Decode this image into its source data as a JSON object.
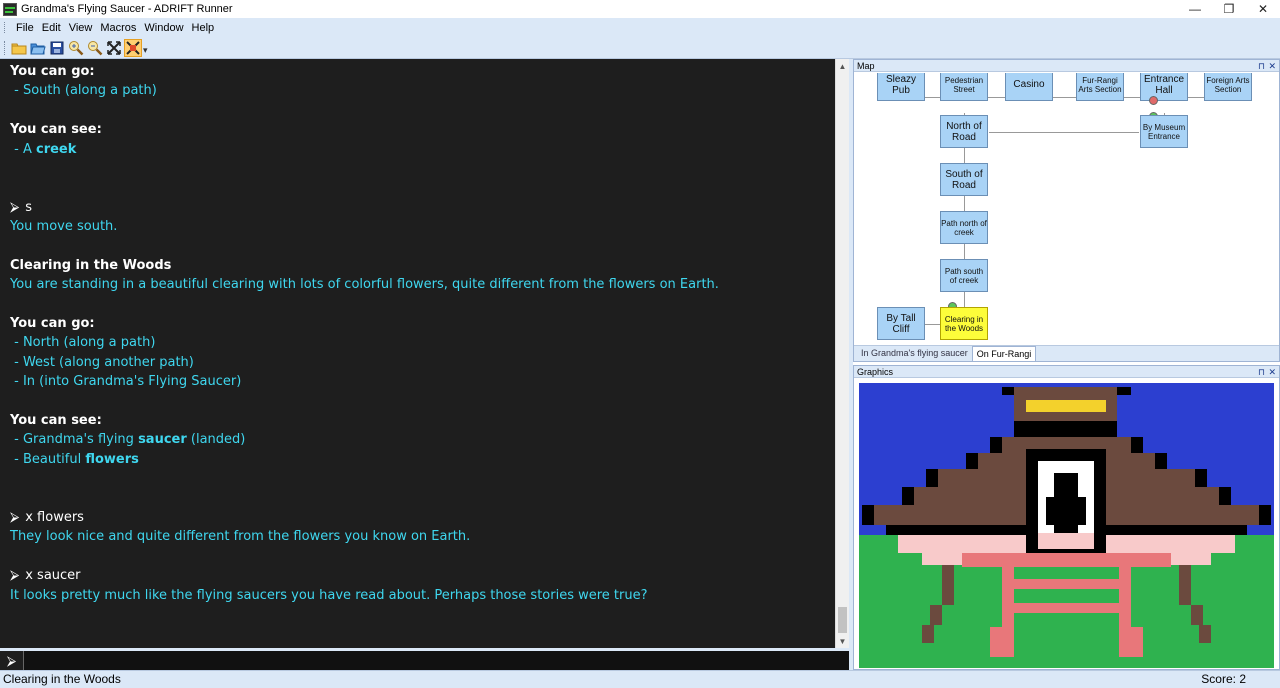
{
  "window": {
    "title": "Grandma's Flying Saucer - ADRIFT Runner",
    "minimize": "—",
    "restore": "❐",
    "close": "✕"
  },
  "menu": [
    "File",
    "Edit",
    "View",
    "Macros",
    "Window",
    "Help"
  ],
  "toolbar": {
    "buttons": [
      "open-folder-icon",
      "open-file-icon",
      "save-icon",
      "zoom-in-icon",
      "zoom-out-icon",
      "fullscreen-icon",
      "map-toggle-icon"
    ],
    "more": "▾"
  },
  "output": {
    "lines": [
      {
        "type": "head",
        "text": "You can go:"
      },
      {
        "type": "text",
        "text": " - South (along a path)"
      },
      {
        "type": "blank",
        "text": ""
      },
      {
        "type": "head",
        "text": "You can see:"
      },
      {
        "type": "text",
        "parts": [
          {
            "t": " - A ",
            "b": false
          },
          {
            "t": "creek",
            "b": true
          }
        ]
      },
      {
        "type": "blank",
        "text": ""
      },
      {
        "type": "blank",
        "text": ""
      },
      {
        "type": "cmd",
        "text": "s"
      },
      {
        "type": "text",
        "text": "You move south."
      },
      {
        "type": "blank",
        "text": ""
      },
      {
        "type": "head",
        "text": "Clearing in the Woods"
      },
      {
        "type": "text",
        "text": "You are standing in a beautiful clearing with lots of colorful flowers, quite different from the flowers on Earth."
      },
      {
        "type": "blank",
        "text": ""
      },
      {
        "type": "head",
        "text": "You can go:"
      },
      {
        "type": "text",
        "text": " - North (along a path)"
      },
      {
        "type": "text",
        "text": " - West (along another path)"
      },
      {
        "type": "text",
        "text": " - In (into Grandma's Flying Saucer)"
      },
      {
        "type": "blank",
        "text": ""
      },
      {
        "type": "head",
        "text": "You can see:"
      },
      {
        "type": "text",
        "parts": [
          {
            "t": " - Grandma's flying ",
            "b": false
          },
          {
            "t": "saucer",
            "b": true
          },
          {
            "t": " (landed)",
            "b": false
          }
        ]
      },
      {
        "type": "text",
        "parts": [
          {
            "t": " - Beautiful ",
            "b": false
          },
          {
            "t": "flowers",
            "b": true
          }
        ]
      },
      {
        "type": "blank",
        "text": ""
      },
      {
        "type": "blank",
        "text": ""
      },
      {
        "type": "cmd",
        "text": "x flowers"
      },
      {
        "type": "text",
        "text": "They look nice and quite different from the flowers you know on Earth."
      },
      {
        "type": "blank",
        "text": ""
      },
      {
        "type": "cmd",
        "text": "x saucer"
      },
      {
        "type": "text",
        "text": "It looks pretty much like the flying saucers you have read about. Perhaps those stories were true?"
      }
    ],
    "prompt_symbol": "⮚"
  },
  "command": {
    "prompt": "⮚",
    "value": "",
    "placeholder": ""
  },
  "map": {
    "title": "Map",
    "pin": "⊓",
    "close": "✕",
    "rooms": {
      "sleazy_pub": "Sleazy Pub",
      "pedestrian_street": "Pedestrian Street",
      "casino": "Casino",
      "fur_rangi_arts": "Fur-Rangi Arts Section",
      "entrance_hall": "Entrance Hall",
      "foreign_arts": "Foreign Arts Section",
      "north_of_road": "North of Road",
      "by_museum_entrance": "By Museum Entrance",
      "south_of_road": "South of Road",
      "path_north_creek": "Path north of creek",
      "path_south_creek": "Path south of creek",
      "by_tall_cliff": "By Tall Cliff",
      "clearing_woods": "Clearing in the Woods"
    },
    "tabs": [
      "In Grandma's flying saucer",
      "On Fur-Rangi"
    ],
    "active_tab": "On Fur-Rangi"
  },
  "graphics": {
    "title": "Graphics",
    "pin": "⊓",
    "close": "✕"
  },
  "status": {
    "location": "Clearing in the Woods",
    "score": "Score: 2"
  },
  "colors": {
    "output_bg": "#1e1e1e",
    "output_text": "#3fd7ef",
    "room_fill": "#a9d3f6",
    "current_room_fill": "#fdfd3a",
    "chrome": "#dbe8f7",
    "sky": "#2c3fd0",
    "grass": "#2fb24f",
    "hat_brown": "#6b4a3e",
    "hat_gold": "#f3d12c",
    "pink": "#f8caca",
    "salmon": "#e8777a"
  }
}
